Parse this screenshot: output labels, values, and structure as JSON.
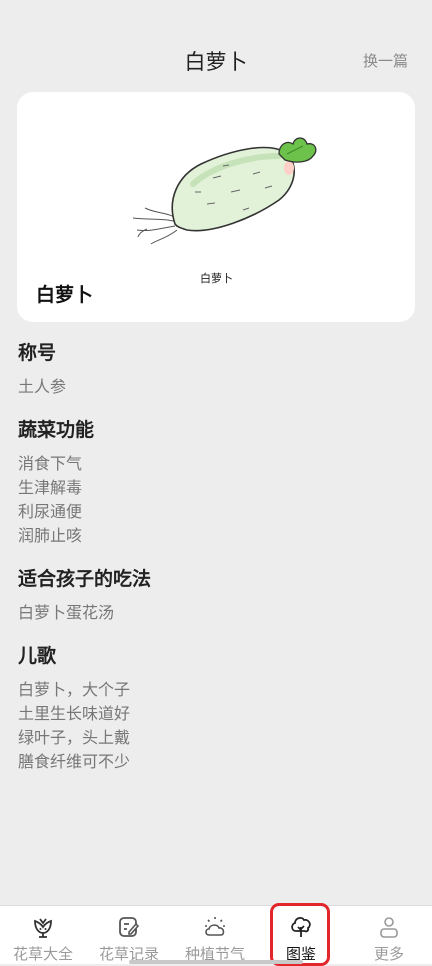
{
  "header": {
    "title": "白萝卜",
    "switch_label": "换一篇"
  },
  "card": {
    "name": "白萝卜",
    "image_caption": "白萝卜"
  },
  "sections": [
    {
      "title": "称号",
      "lines": [
        "土人参"
      ]
    },
    {
      "title": "蔬菜功能",
      "lines": [
        "消食下气",
        "生津解毒",
        "利尿通便",
        "润肺止咳"
      ]
    },
    {
      "title": "适合孩子的吃法",
      "lines": [
        "白萝卜蛋花汤"
      ]
    },
    {
      "title": "儿歌",
      "lines": [
        "白萝卜，大个子",
        "土里生长味道好",
        "绿叶子，头上戴",
        "膳食纤维可不少"
      ]
    }
  ],
  "tabbar": {
    "tabs": [
      {
        "label": "花草大全",
        "icon": "flower-icon"
      },
      {
        "label": "花草记录",
        "icon": "notebook-edit-icon"
      },
      {
        "label": "种植节气",
        "icon": "weather-cloud-icon"
      },
      {
        "label": "图鉴",
        "icon": "tree-icon",
        "active": true
      },
      {
        "label": "更多",
        "icon": "person-icon"
      }
    ],
    "highlight_color": "#e2262b"
  }
}
